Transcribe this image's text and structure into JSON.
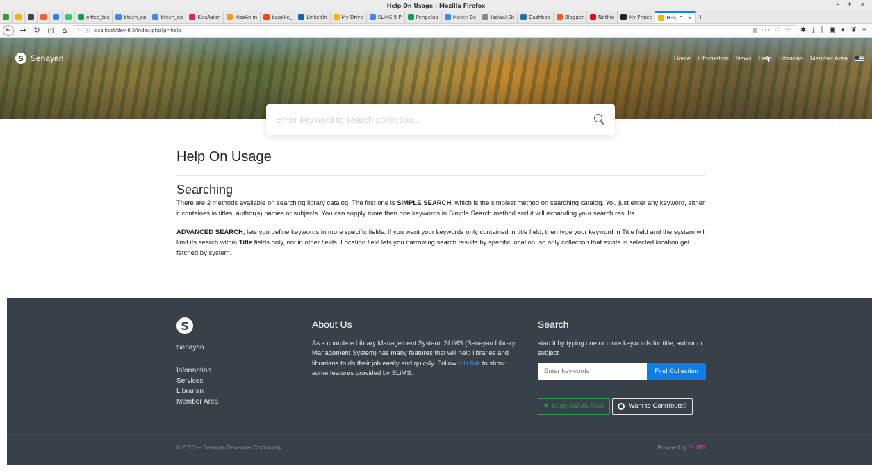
{
  "window": {
    "title": "Help On Usage - Mozilla Firefox",
    "controls": "– + ×"
  },
  "tabs": [
    {
      "label": "",
      "color": "#3a9a3a",
      "pinned": true
    },
    {
      "label": "",
      "color": "#f4b400",
      "pinned": true
    },
    {
      "label": "",
      "color": "#444444",
      "pinned": true
    },
    {
      "label": "",
      "color": "#ff5a36",
      "pinned": true
    },
    {
      "label": "",
      "color": "#2684ff",
      "pinned": true
    },
    {
      "label": "",
      "color": "#25d366",
      "pinned": true
    },
    {
      "label": "office_tas",
      "color": "#0f9d58"
    },
    {
      "label": "btech_op",
      "color": "#4285f4"
    },
    {
      "label": "btech_op",
      "color": "#4285f4"
    },
    {
      "label": "KissAsian",
      "color": "#e0245e"
    },
    {
      "label": "KissAnim",
      "color": "#f39c12"
    },
    {
      "label": "bapake_",
      "color": "#ff4500"
    },
    {
      "label": "LinkedIn",
      "color": "#0a66c2"
    },
    {
      "label": "My Drive",
      "color": "#f4b400"
    },
    {
      "label": "SLiMS 9 P",
      "color": "#4285f4"
    },
    {
      "label": "Pengelua",
      "color": "#0f9d58"
    },
    {
      "label": "Materi Be",
      "color": "#4285f4"
    },
    {
      "label": "Jadwal Sh",
      "color": "#888888"
    },
    {
      "label": "Dashboa",
      "color": "#21759b"
    },
    {
      "label": "Blogger",
      "color": "#ff5722"
    },
    {
      "label": "Netflix",
      "color": "#e50914"
    },
    {
      "label": "My Projec",
      "color": "#222222"
    },
    {
      "label": "Help C",
      "color": "#f4b400",
      "active": true
    }
  ],
  "nav": {
    "url": "localhost/dev-8.5/index.php?p=help",
    "page_actions": "··· ♡ ☆",
    "toolbar_icons": [
      "puzzle-icon",
      "download-icon",
      "library-icon",
      "reader-icon",
      "shield-icon",
      "extension-icon",
      "menu-icon"
    ]
  },
  "site": {
    "brand": "Senayan",
    "menu": [
      "Home",
      "Information",
      "News",
      "Help",
      "Librarian",
      "Member Area"
    ],
    "active_menu": "Help",
    "search_placeholder": "Enter keyword to search collection..."
  },
  "content": {
    "title": "Help On Usage",
    "section_title": "Searching",
    "p1_prefix": "There are 2 methods available on searching library catalog. The first one is ",
    "p1_bold": "SIMPLE SEARCH",
    "p1_suffix": ", which is the simplest method on searching catalog. You just enter any keyword, either it containes in titles, author(s) names or subjects. You can supply more than one keywords in Simple Search method and it will expanding your search results.",
    "p2_bold1": "ADVANCED SEARCH",
    "p2_mid": ", lets you define keywords in more specific fields. If you want your keywords only contained in title field, then type your keyword in Title field and the system will limit its search within ",
    "p2_bold2": "Title",
    "p2_suffix": " fields only, not in other fields. Location field lets you narrowing search results by specific location, so only collection that exists in selected location get fetched by system."
  },
  "footer": {
    "brand": "Senayan",
    "links": [
      "Information",
      "Services",
      "Librarian",
      "Member Area"
    ],
    "about_title": "About Us",
    "about_text": "As a complete Library Management System, SLiMS (Senayan Library Management System) has many features that will help libraries and librarians to do their job easily and quickly. Follow ",
    "about_link": "this link",
    "about_text2": " to show some features provided by SLiMS.",
    "search_title": "Search",
    "search_text": "start it by typing one or more keywords for title, author or subject",
    "search_placeholder": "Enter keywords",
    "search_button": "Find Collection",
    "alive_button": "Keep SLiMS Alive",
    "contribute_button": "Want to Contribute?",
    "copyright": "© 2020 — Senayan Developer Community",
    "powered_by": "Powered by ",
    "powered_name": "SLiMS"
  }
}
